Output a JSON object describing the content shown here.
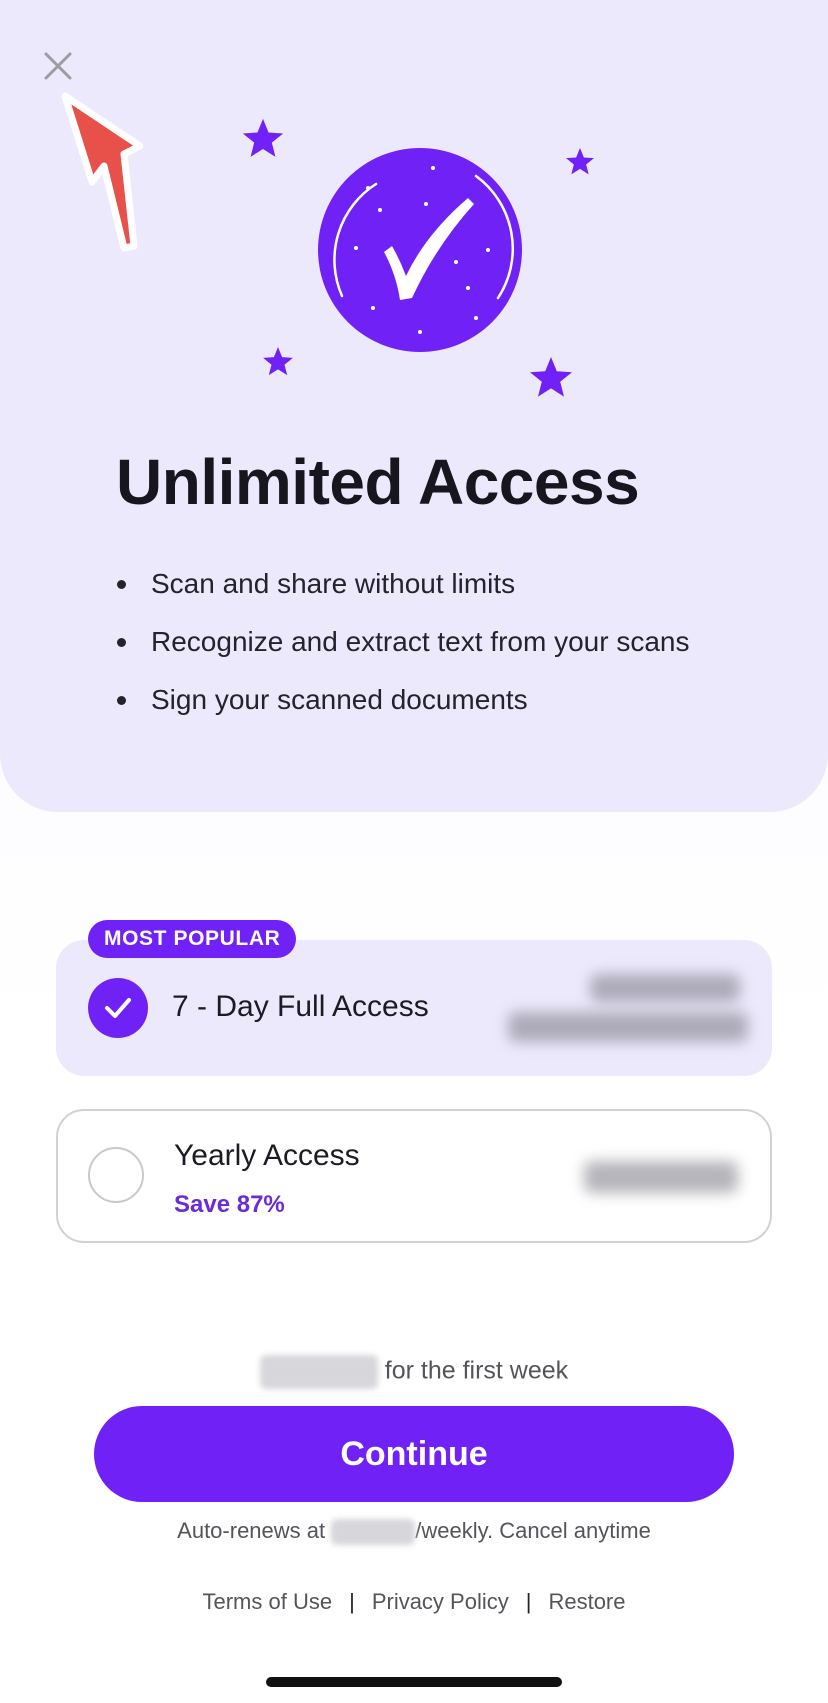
{
  "hero": {
    "title": "Unlimited Access",
    "features": [
      "Scan and share without limits",
      "Recognize and extract text from your scans",
      "Sign your scanned documents"
    ]
  },
  "icons": {
    "close": "close-icon",
    "pointer": "red-arrow-annotation",
    "badge": "checkmark-badge-icon",
    "stars": "star-icon"
  },
  "plans": [
    {
      "tag": "MOST POPULAR",
      "name": "7 - Day Full Access",
      "selected": true
    },
    {
      "name": "Yearly Access",
      "save": "Save 87%",
      "selected": false
    }
  ],
  "cta": {
    "intro_suffix": "for the first week",
    "continue_label": "Continue",
    "renew_prefix": "Auto-renews at",
    "renew_suffix": "/weekly. Cancel anytime"
  },
  "footer": {
    "terms": "Terms of Use",
    "separator": "|",
    "privacy": "Privacy Policy",
    "restore": "Restore"
  },
  "colors": {
    "accent": "#7022f6",
    "hero_background": "#ece9fc",
    "annotation_arrow": "#e8504a"
  }
}
